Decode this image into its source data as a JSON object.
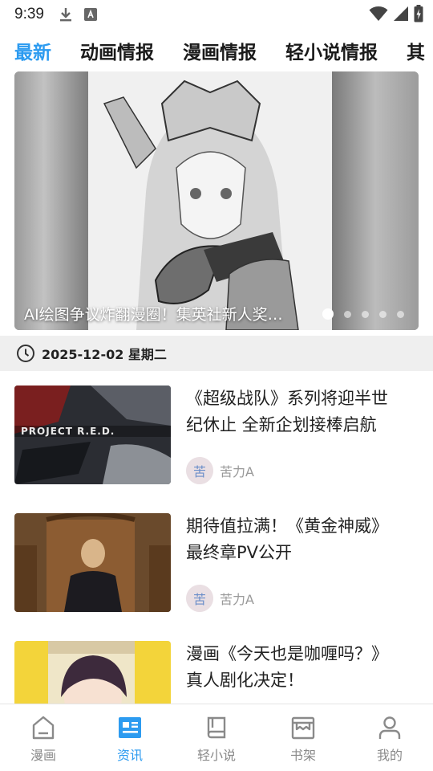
{
  "status_bar": {
    "time": "9:39"
  },
  "tabs": [
    {
      "label": "最新",
      "active": true
    },
    {
      "label": "动画情报",
      "active": false
    },
    {
      "label": "漫画情报",
      "active": false
    },
    {
      "label": "轻小说情报",
      "active": false
    },
    {
      "label": "其",
      "active": false
    }
  ],
  "banner": {
    "caption": "AI绘图争议炸翻漫圈！集英社新人奖…",
    "slide_count": 5,
    "active_slide": 1
  },
  "date_header": {
    "text": "2025-12-02 星期二"
  },
  "news": [
    {
      "title_line1": "《超级战队》系列将迎半世",
      "title_line2": "纪休止 全新企划接棒启航",
      "author": "苦力A",
      "thumb_text": "PROJECT R.E.D."
    },
    {
      "title_line1": "期待值拉满！《黄金神威》",
      "title_line2": "最终章PV公开",
      "author": "苦力A"
    },
    {
      "title_line1": "漫画《今天也是咖喱吗？》",
      "title_line2": "真人剧化决定！",
      "author": ""
    }
  ],
  "bottom_nav": [
    {
      "label": "漫画",
      "icon": "home-icon",
      "active": false
    },
    {
      "label": "资讯",
      "icon": "news-icon",
      "active": true
    },
    {
      "label": "轻小说",
      "icon": "book-icon",
      "active": false
    },
    {
      "label": "书架",
      "icon": "bookshelf-icon",
      "active": false
    },
    {
      "label": "我的",
      "icon": "profile-icon",
      "active": false
    }
  ],
  "colors": {
    "accent": "#2c9bf0",
    "text": "#222222",
    "muted": "#999999",
    "date_bar_bg": "#efefef"
  }
}
